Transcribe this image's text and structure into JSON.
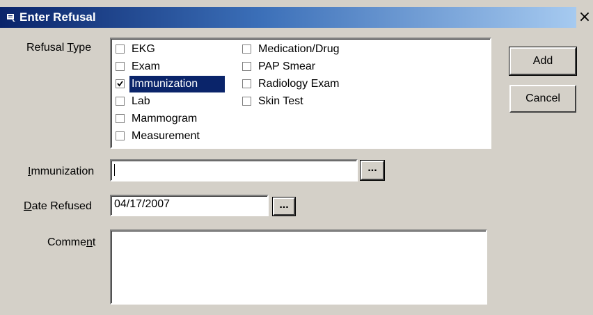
{
  "window": {
    "title": "Enter Refusal",
    "close_glyph": "×"
  },
  "refusal_type": {
    "label_pre": "Refusal ",
    "label_key": "T",
    "label_post": "ype",
    "options_col1": [
      {
        "label": "EKG",
        "checked": false
      },
      {
        "label": "Exam",
        "checked": false
      },
      {
        "label": "Immunization",
        "checked": true,
        "selected": true
      },
      {
        "label": "Lab",
        "checked": false
      },
      {
        "label": "Mammogram",
        "checked": false
      },
      {
        "label": "Measurement",
        "checked": false
      }
    ],
    "options_col2": [
      {
        "label": "Medication/Drug",
        "checked": false
      },
      {
        "label": "PAP Smear",
        "checked": false
      },
      {
        "label": "Radiology Exam",
        "checked": false
      },
      {
        "label": "Skin Test",
        "checked": false
      }
    ]
  },
  "immunization": {
    "label_key": "I",
    "label_post": "mmunization",
    "value": "",
    "browse_label": "..."
  },
  "date_refused": {
    "label_key": "D",
    "label_post": "ate Refused",
    "value": "04/17/2007",
    "browse_label": "..."
  },
  "comment": {
    "label_pre": "Comme",
    "label_key": "n",
    "label_post": "t",
    "value": ""
  },
  "buttons": {
    "add_label": "Add",
    "cancel_label": "Cancel"
  }
}
